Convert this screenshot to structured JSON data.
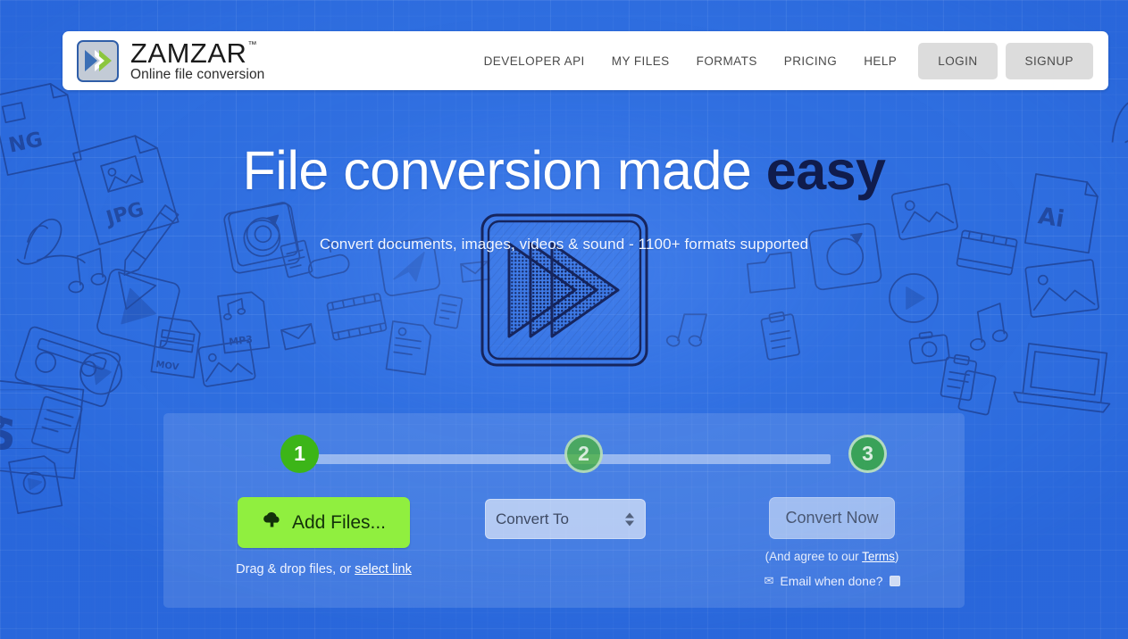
{
  "header": {
    "logo": {
      "mark_icon": "double-chevron-icon",
      "brand": "ZAMZAR",
      "trademark": "™",
      "tagline": "Online file conversion"
    },
    "nav_links": [
      {
        "label": "DEVELOPER API",
        "name": "nav-developer-api"
      },
      {
        "label": "MY FILES",
        "name": "nav-my-files"
      },
      {
        "label": "FORMATS",
        "name": "nav-formats"
      },
      {
        "label": "PRICING",
        "name": "nav-pricing"
      },
      {
        "label": "HELP",
        "name": "nav-help"
      }
    ],
    "login_label": "LOGIN",
    "signup_label": "SIGNUP"
  },
  "hero": {
    "title_light": "File conversion made",
    "title_strong": "easy",
    "subtitle": "Convert documents, images, videos & sound - 1100+ formats supported",
    "icon": "fast-forward-sketch-icon"
  },
  "converter": {
    "steps": [
      {
        "number": "1",
        "name": "step-1-indicator"
      },
      {
        "number": "2",
        "name": "step-2-indicator"
      },
      {
        "number": "3",
        "name": "step-3-indicator"
      }
    ],
    "step1": {
      "button_label": "Add Files...",
      "button_icon": "cloud-upload-icon",
      "hint_prefix": "Drag & drop files, or ",
      "hint_link": "select link"
    },
    "step2": {
      "select_value": "Convert To",
      "select_placeholder": "Convert To"
    },
    "step3": {
      "convert_label": "Convert Now",
      "terms_prefix": "(And agree to our ",
      "terms_link": "Terms",
      "terms_suffix": ")",
      "email_icon": "envelope-icon",
      "email_label": "Email when done?",
      "email_checked": false
    }
  },
  "colors": {
    "background_blue": "#2f6fe0",
    "panel_overlay": "rgba(255,255,255,0.12)",
    "accent_green": "#90ef3f",
    "step_green": "#3cb518",
    "dark_navy": "#101c4d",
    "header_white": "#ffffff",
    "nav_button_gray": "#dcdcdc"
  }
}
